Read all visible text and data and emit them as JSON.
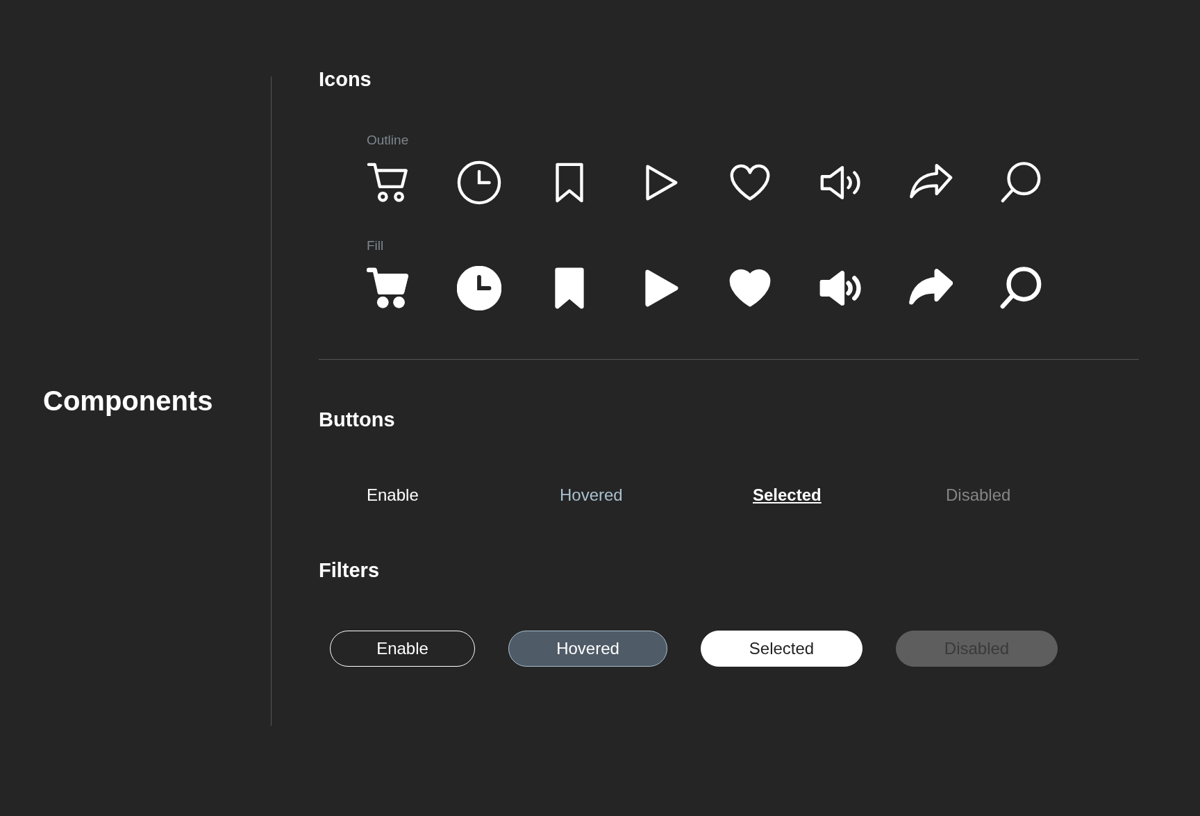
{
  "sidebar": {
    "title": "Components"
  },
  "icons": {
    "title": "Icons",
    "sets": [
      {
        "label": "Outline",
        "kind": "outline"
      },
      {
        "label": "Fill",
        "kind": "fill"
      }
    ]
  },
  "buttons": {
    "title": "Buttons",
    "items": [
      {
        "label": "Enable",
        "kind": "enable"
      },
      {
        "label": "Hovered",
        "kind": "hovered"
      },
      {
        "label": "Selected",
        "kind": "selected"
      },
      {
        "label": "Disabled",
        "kind": "disabled"
      }
    ]
  },
  "filters": {
    "title": "Filters",
    "items": [
      {
        "label": "Enable",
        "kind": "enable"
      },
      {
        "label": "Hovered",
        "kind": "hovered"
      },
      {
        "label": "Selected",
        "kind": "selected"
      },
      {
        "label": "Disabled",
        "kind": "disabled"
      }
    ]
  }
}
